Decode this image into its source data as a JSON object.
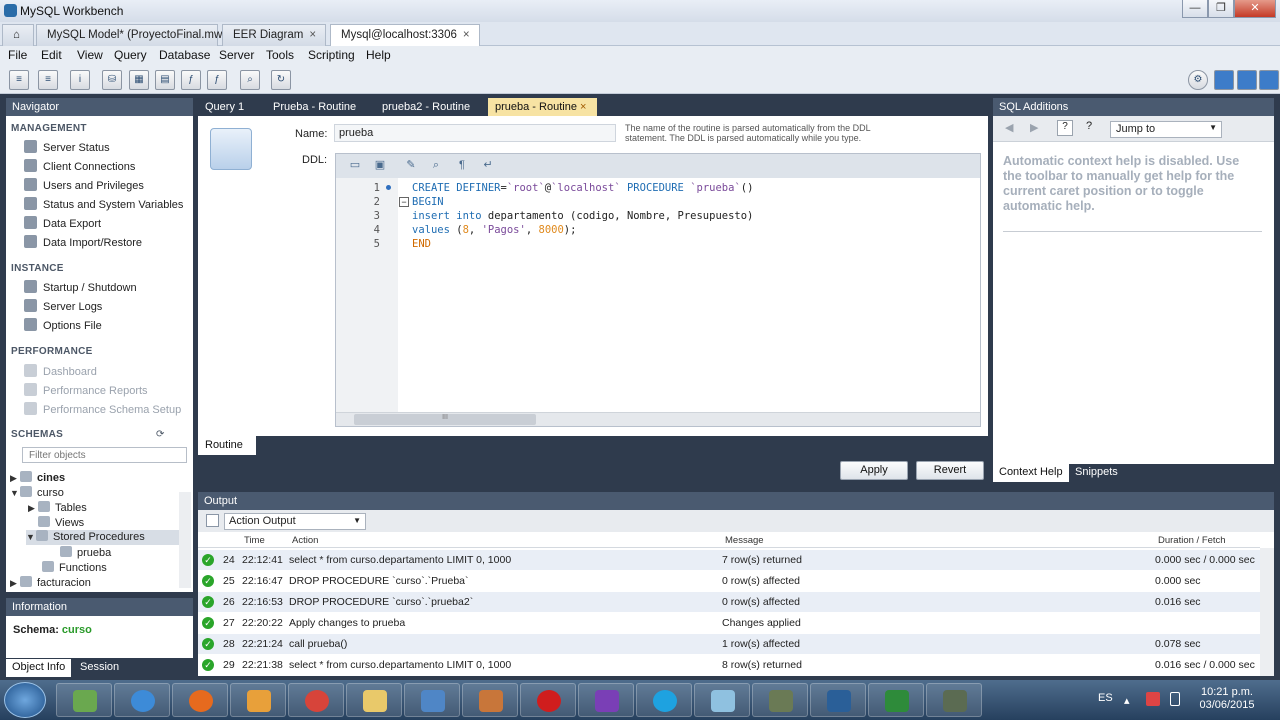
{
  "window": {
    "title": "MySQL Workbench",
    "minimize": "—",
    "maximize": "❐",
    "close": "✕"
  },
  "file_tabs": [
    {
      "label": "MySQL Model* (ProyectoFinal.mwb)"
    },
    {
      "label": "EER Diagram"
    },
    {
      "label": "Mysql@localhost:3306"
    }
  ],
  "menu": [
    "File",
    "Edit",
    "View",
    "Query",
    "Database",
    "Server",
    "Tools",
    "Scripting",
    "Help"
  ],
  "navigator": {
    "title": "Navigator",
    "management": {
      "header": "MANAGEMENT",
      "items": [
        "Server Status",
        "Client Connections",
        "Users and Privileges",
        "Status and System Variables",
        "Data Export",
        "Data Import/Restore"
      ]
    },
    "instance": {
      "header": "INSTANCE",
      "items": [
        "Startup / Shutdown",
        "Server Logs",
        "Options File"
      ]
    },
    "performance": {
      "header": "PERFORMANCE",
      "items": [
        "Dashboard",
        "Performance Reports",
        "Performance Schema Setup"
      ]
    },
    "schemas": {
      "header": "SCHEMAS",
      "filter_placeholder": "Filter objects",
      "tree": [
        "cines",
        "curso",
        "Tables",
        "Views",
        "Stored Procedures",
        "prueba",
        "Functions",
        "facturacion"
      ]
    }
  },
  "information": {
    "title": "Information",
    "schema_label": "Schema:",
    "schema_value": "curso"
  },
  "left_bottom_tabs": [
    "Object Info",
    "Session"
  ],
  "query_tabs": [
    "Query 1",
    "Prueba - Routine",
    "prueba2 - Routine",
    "prueba - Routine"
  ],
  "routine_editor": {
    "name_label": "Name:",
    "name_value": "prueba",
    "hint": "The name of the routine is parsed automatically from the DDL statement. The DDL is parsed automatically while you type.",
    "ddl_label": "DDL:",
    "line_numbers": [
      "1",
      "2",
      "3",
      "4",
      "5"
    ],
    "code_lines": [
      {
        "kw1": "CREATE DEFINER",
        "t1": "=",
        "s1": "`root`",
        "t2": "@",
        "s2": "`localhost`",
        "kw2": " PROCEDURE ",
        "s3": "`prueba`",
        "t3": "()"
      },
      {
        "kw1": "BEGIN"
      },
      {
        "kw1": "insert into",
        "t1": " departamento (codigo, Nombre, Presupuesto)"
      },
      {
        "kw1": "values",
        "t1": " (",
        "n1": "8",
        "t2": ", ",
        "s1": "'Pagos'",
        "t3": ", ",
        "n2": "8000",
        "t4": ");"
      },
      {
        "fn": "END"
      }
    ],
    "scroll_grip": "III",
    "bottom_tab": "Routine",
    "apply": "Apply",
    "revert": "Revert"
  },
  "sql_additions": {
    "title": "SQL Additions",
    "jump_to": "Jump to",
    "help_text": "Automatic context help is disabled. Use the toolbar to manually get help for the current caret position or to toggle automatic help.",
    "tabs": [
      "Context Help",
      "Snippets"
    ]
  },
  "output": {
    "title": "Output",
    "selector": "Action Output",
    "columns": {
      "time": "Time",
      "action": "Action",
      "message": "Message",
      "duration": "Duration / Fetch"
    },
    "rows": [
      {
        "n": "24",
        "time": "22:12:41",
        "action": "select * from curso.departamento LIMIT 0, 1000",
        "message": "7 row(s) returned",
        "duration": "0.000 sec / 0.000 sec"
      },
      {
        "n": "25",
        "time": "22:16:47",
        "action": "DROP PROCEDURE `curso`.`Prueba`",
        "message": "0 row(s) affected",
        "duration": "0.000 sec"
      },
      {
        "n": "26",
        "time": "22:16:53",
        "action": "DROP PROCEDURE `curso`.`prueba2`",
        "message": "0 row(s) affected",
        "duration": "0.016 sec"
      },
      {
        "n": "27",
        "time": "22:20:22",
        "action": "Apply changes to prueba",
        "message": "Changes applied",
        "duration": ""
      },
      {
        "n": "28",
        "time": "22:21:24",
        "action": "call prueba()",
        "message": "1 row(s) affected",
        "duration": "0.078 sec"
      },
      {
        "n": "29",
        "time": "22:21:38",
        "action": "select * from curso.departamento LIMIT 0, 1000",
        "message": "8 row(s) returned",
        "duration": "0.016 sec / 0.000 sec"
      }
    ]
  },
  "taskbar": {
    "lang": "ES",
    "time": "10:21 p.m.",
    "date": "03/06/2015"
  }
}
